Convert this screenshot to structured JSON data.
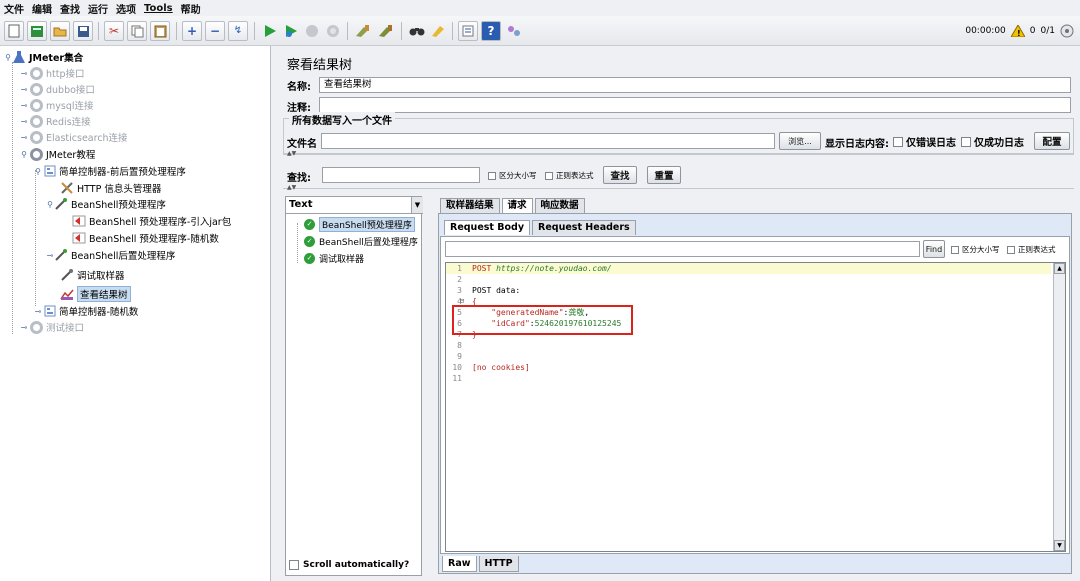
{
  "menu": [
    "文件",
    "编辑",
    "查找",
    "运行",
    "选项",
    "Tools",
    "帮助"
  ],
  "status": {
    "time": "00:00:00",
    "warnings": "0",
    "threads": "0/1"
  },
  "tree": [
    {
      "label": "JMeter集合",
      "icon": "flask-icon",
      "disabled": false
    },
    {
      "label": "http接口",
      "icon": "gear-icon",
      "disabled": true
    },
    {
      "label": "dubbo接口",
      "icon": "gear-icon",
      "disabled": true
    },
    {
      "label": "mysql连接",
      "icon": "gear-icon",
      "disabled": true
    },
    {
      "label": "Redis连接",
      "icon": "gear-icon",
      "disabled": true
    },
    {
      "label": "Elasticsearch连接",
      "icon": "gear-icon",
      "disabled": true
    },
    {
      "label": "JMeter教程",
      "icon": "gear-icon",
      "disabled": false
    },
    {
      "label": "简单控制器-前后置预处理程序",
      "icon": "controller-icon",
      "disabled": false
    },
    {
      "label": "HTTP 信息头管理器",
      "icon": "wrench-icon",
      "disabled": false
    },
    {
      "label": "BeanShell预处理程序",
      "icon": "pipette-icon",
      "disabled": false
    },
    {
      "label": "BeanShell 预处理程序-引入jar包",
      "icon": "red-arrow-icon",
      "disabled": false
    },
    {
      "label": "BeanShell 预处理程序-随机数",
      "icon": "red-arrow-icon",
      "disabled": false
    },
    {
      "label": "BeanShell后置处理程序",
      "icon": "pipette-icon",
      "disabled": false
    },
    {
      "label": "调试取样器",
      "icon": "pipette-icon",
      "disabled": false
    },
    {
      "label": "查看结果树",
      "icon": "chart-icon",
      "disabled": false,
      "selected": true
    },
    {
      "label": "简单控制器-随机数",
      "icon": "controller-icon",
      "disabled": false
    },
    {
      "label": "测试接口",
      "icon": "gear-icon",
      "disabled": true
    }
  ],
  "panel": {
    "title": "察看结果树",
    "name_label": "名称:",
    "name_value": "查看结果树",
    "comment_label": "注释:",
    "comment_value": "",
    "group_title": "所有数据写入一个文件",
    "filename_label": "文件名",
    "filename_value": "",
    "browse_label": "浏览...",
    "log_content_label": "显示日志内容:",
    "errors_only_label": "仅错误日志",
    "success_only_label": "仅成功日志",
    "configure_label": "配置",
    "search_label": "查找:",
    "search_value": "",
    "case_sensitive_label": "区分大小写",
    "regex_label": "正则表达式",
    "search_button": "查找",
    "reset_button": "重置"
  },
  "renderer": {
    "selected": "Text",
    "samples": [
      {
        "label": "BeanShell预处理程序",
        "selected": true
      },
      {
        "label": "BeanShell后置处理程序",
        "selected": false
      },
      {
        "label": "调试取样器",
        "selected": false
      }
    ],
    "scroll_label": "Scroll automatically?"
  },
  "result_tabs": [
    "取样器结果",
    "请求",
    "响应数据"
  ],
  "request_tabs": [
    "Request Body",
    "Request Headers"
  ],
  "find": {
    "value": "",
    "button": "Find",
    "case_sensitive_label": "区分大小写",
    "regex_label": "正则表达式"
  },
  "code": {
    "method": "POST",
    "url": "https://note.youdao.com/",
    "post_data_label": "POST data:",
    "open_brace": "{",
    "key1": "\"generatedName\"",
    "val1": "龚敬",
    "key2": "\"idCard\"",
    "val2": "524620197610125245",
    "close_brace": "}",
    "cookies": "[no cookies]",
    "line_numbers": [
      "1",
      "2",
      "3",
      "4",
      "5",
      "6",
      "7",
      "8",
      "9",
      "10",
      "11"
    ]
  },
  "bottom_tabs": [
    "Raw",
    "HTTP"
  ]
}
